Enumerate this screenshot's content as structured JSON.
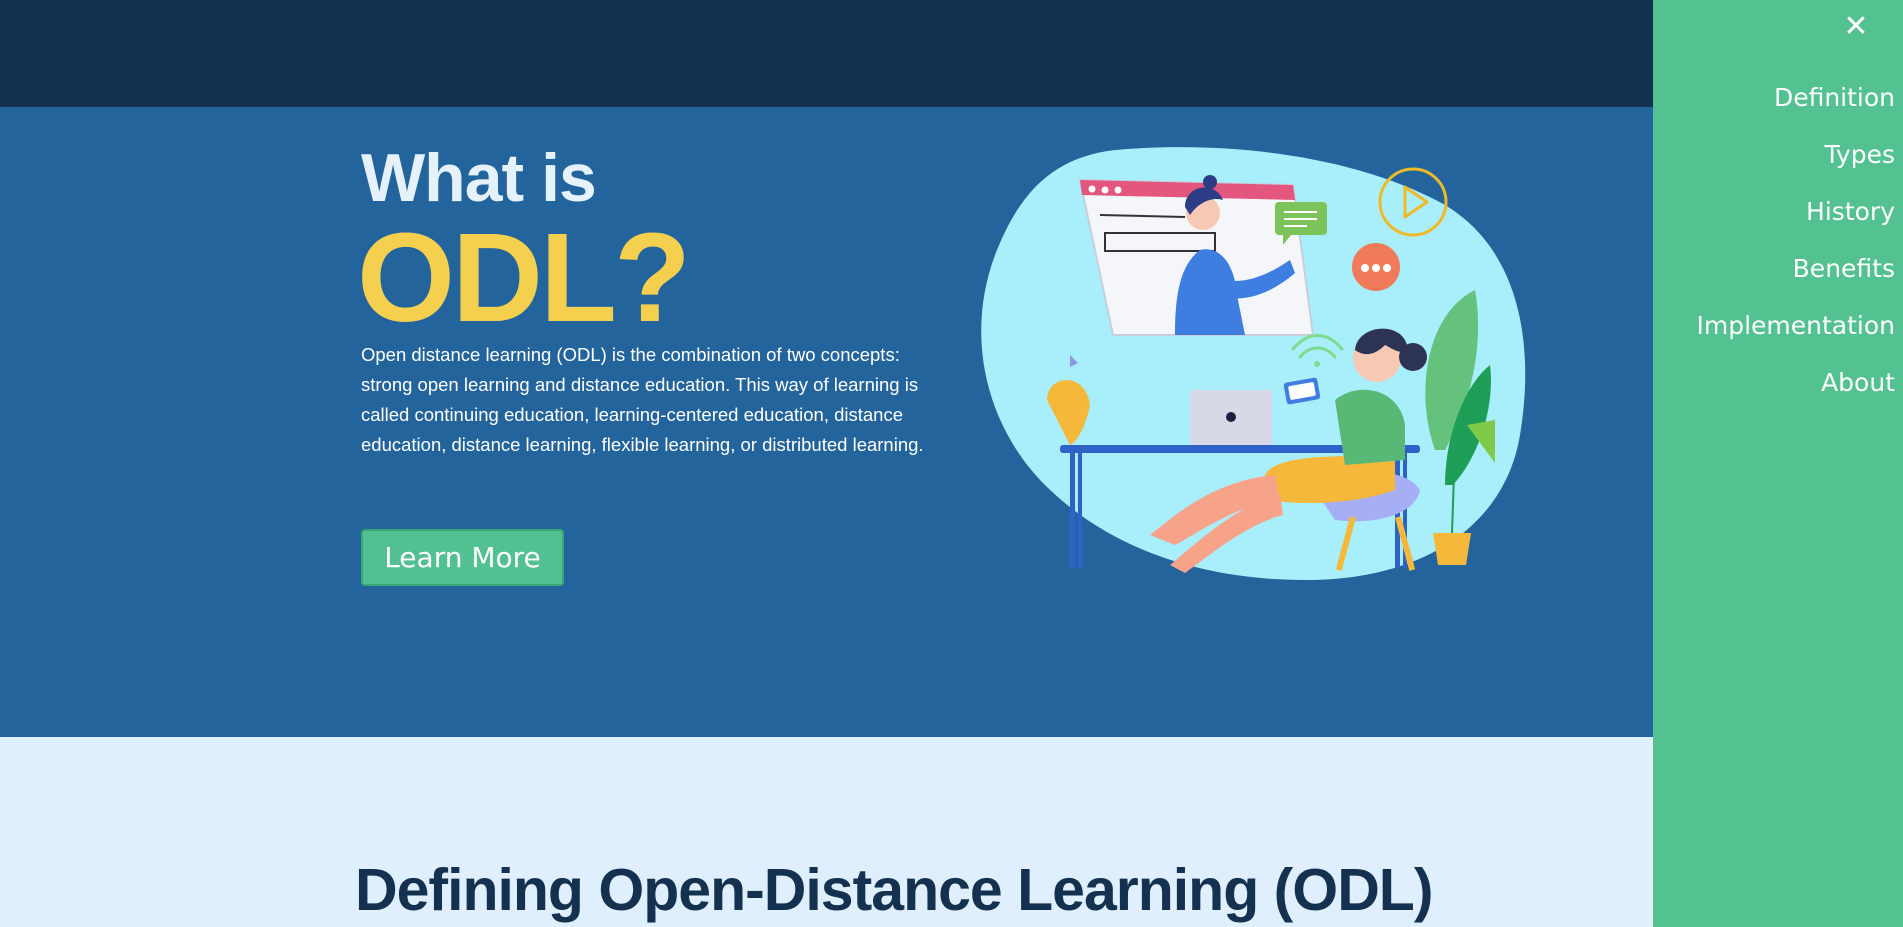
{
  "hero": {
    "title_line1": "What is",
    "title_line2": "ODL?",
    "description": "Open distance learning (ODL) is the combination of two concepts: strong open learning and distance education. This way of learning is called continuing education, learning-centered education, distance education, distance learning, flexible learning, or distributed learning.",
    "button_label": "Learn More"
  },
  "section": {
    "title": "Defining Open-Distance Learning (ODL)"
  },
  "sidenav": {
    "close_label": "✕",
    "items": [
      {
        "label": "Definition"
      },
      {
        "label": "Types"
      },
      {
        "label": "History"
      },
      {
        "label": "Benefits"
      },
      {
        "label": "Implementation"
      },
      {
        "label": "About"
      }
    ]
  },
  "colors": {
    "topbar": "#14324f",
    "hero_bg": "#22649b",
    "accent_yellow": "#f5d04f",
    "sidenav_green": "#53c190",
    "lower_bg": "#dfeffe"
  },
  "illustration": {
    "icons": [
      "video-window-icon",
      "chat-bubble-icon",
      "play-circle-icon",
      "dots-bubble-icon",
      "wifi-icon",
      "laptop-icon",
      "phone-icon",
      "lamp-icon",
      "plant-icon"
    ]
  }
}
